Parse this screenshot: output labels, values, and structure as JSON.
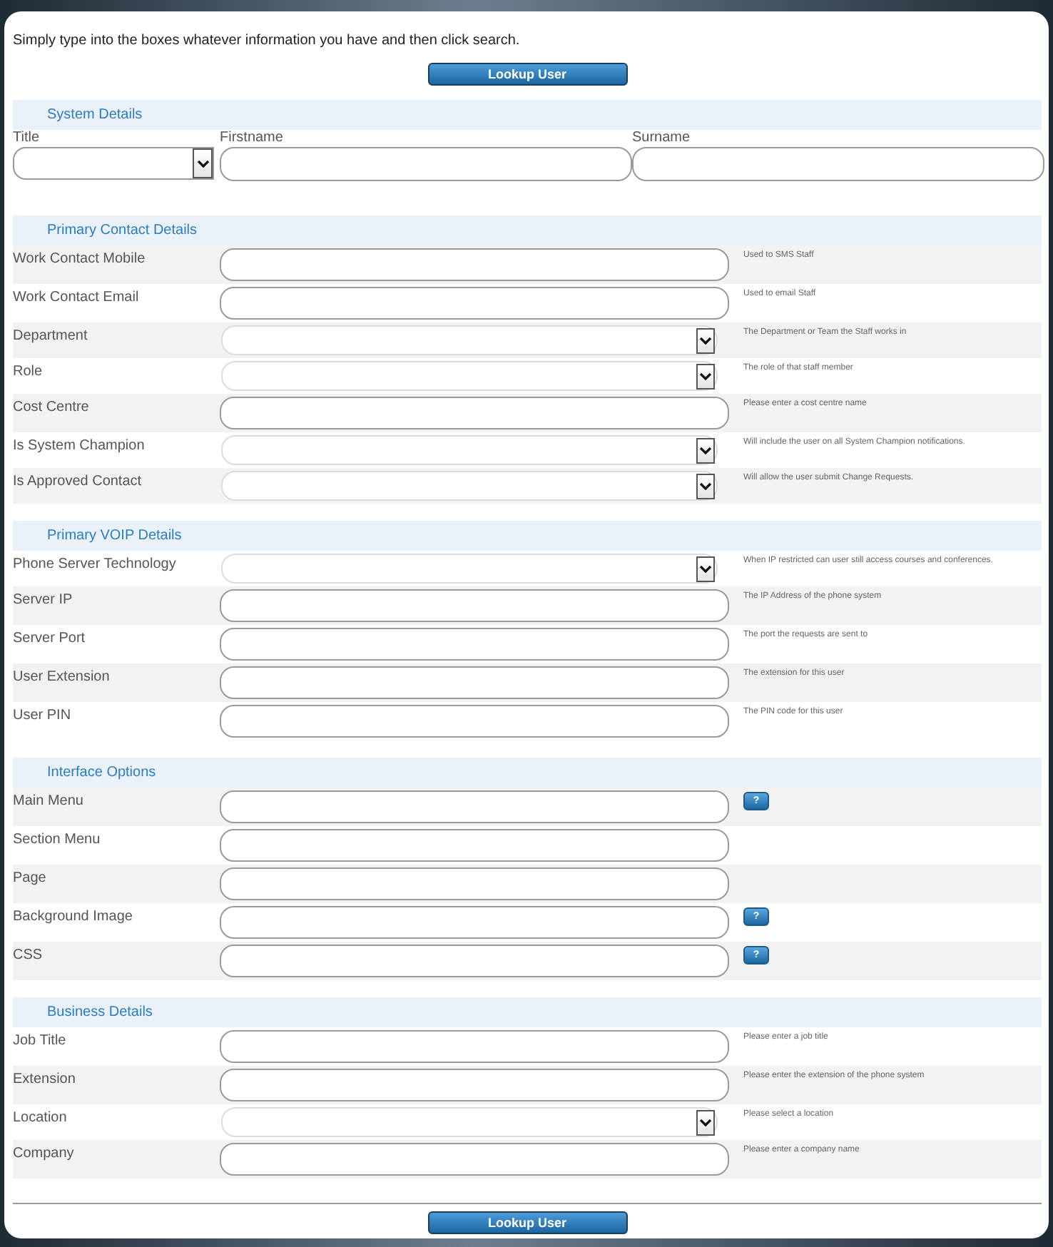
{
  "intro": "Simply type into the boxes whatever information you have and then click search.",
  "top_button": "Lookup User",
  "system_details": {
    "title": "System Details",
    "fields": [
      {
        "label": "Title",
        "kind": "select"
      },
      {
        "label": "Firstname",
        "kind": "text"
      },
      {
        "label": "Surname",
        "kind": "text"
      }
    ]
  },
  "sections": [
    {
      "title": "Primary Contact Details",
      "rows": [
        {
          "label": "Work Contact Mobile",
          "kind": "text",
          "hint": "Used to SMS Staff"
        },
        {
          "label": "Work Contact Email",
          "kind": "text",
          "hint": "Used to email Staff"
        },
        {
          "label": "Department",
          "kind": "select",
          "hint": "The Department or Team the Staff works in"
        },
        {
          "label": "Role",
          "kind": "select",
          "hint": "The role of that staff member"
        },
        {
          "label": "Cost Centre",
          "kind": "text",
          "hint": "Please enter a cost centre name"
        },
        {
          "label": "Is System Champion",
          "kind": "select",
          "hint": "Will include the user on all System Champion notifications."
        },
        {
          "label": "Is Approved Contact",
          "kind": "select",
          "hint": "Will allow the user submit Change Requests."
        }
      ]
    },
    {
      "title": "Primary VOIP Details",
      "rows": [
        {
          "label": "Phone Server Technology",
          "kind": "select",
          "hint": "When IP restricted can user still access courses and conferences."
        },
        {
          "label": "Server IP",
          "kind": "text",
          "hint": "The IP Address of the phone system"
        },
        {
          "label": "Server Port",
          "kind": "text",
          "hint": "The port the requests are sent to"
        },
        {
          "label": "User Extension",
          "kind": "text",
          "hint": "The extension for this user"
        },
        {
          "label": "User PIN",
          "kind": "text",
          "hint": "The PIN code for this user"
        }
      ]
    },
    {
      "title": "Interface Options",
      "rows": [
        {
          "label": "Main Menu",
          "kind": "text",
          "help": "?"
        },
        {
          "label": "Section Menu",
          "kind": "text"
        },
        {
          "label": "Page",
          "kind": "text"
        },
        {
          "label": "Background Image",
          "kind": "text",
          "help": "?"
        },
        {
          "label": "CSS",
          "kind": "text",
          "help": "?"
        }
      ]
    },
    {
      "title": "Business Details",
      "rows": [
        {
          "label": "Job Title",
          "kind": "text",
          "hint": "Please enter a job title"
        },
        {
          "label": "Extension",
          "kind": "text",
          "hint": "Please enter the extension of the phone system"
        },
        {
          "label": "Location",
          "kind": "select",
          "hint": "Please select a location"
        },
        {
          "label": "Company",
          "kind": "text",
          "hint": "Please enter a company name"
        }
      ]
    }
  ],
  "bottom_button": "Lookup User"
}
